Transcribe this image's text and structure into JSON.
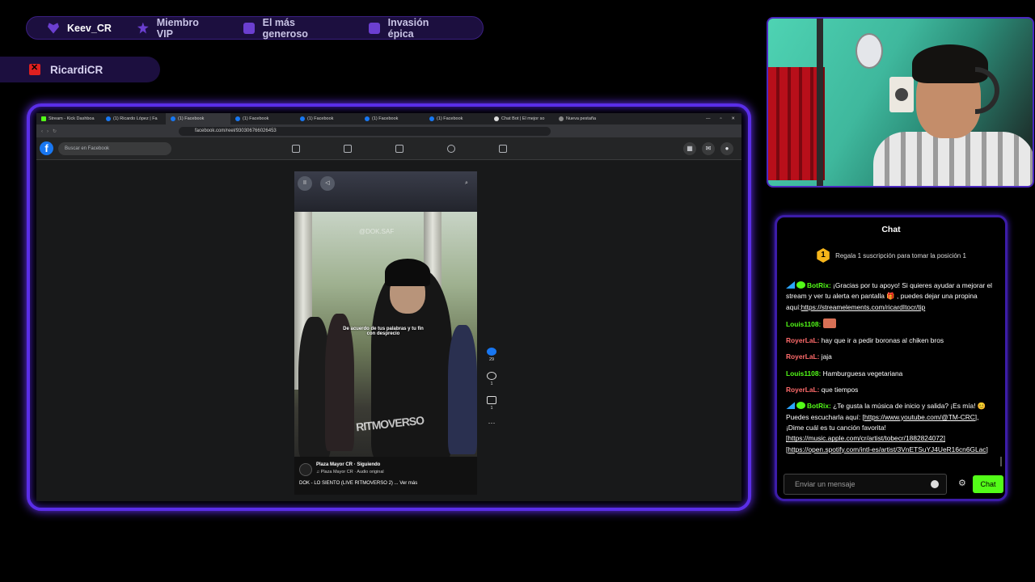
{
  "alerts": {
    "items": [
      {
        "icon": "heart-icon",
        "label": "Keev_CR"
      },
      {
        "icon": "star-icon",
        "label": "Miembro VIP"
      },
      {
        "icon": "gift-icon",
        "label": "El más generoso"
      },
      {
        "icon": "paw-icon",
        "label": "Invasión épica"
      }
    ],
    "streamer": "RicardiCR"
  },
  "browser": {
    "tabs": [
      "Stream - Kick Dashboa",
      "(1) Ricardo López | Fa",
      "(1) Facebook",
      "(1) Facebook",
      "(1) Facebook",
      "(1) Facebook",
      "(1) Facebook",
      "Chat Bot | El mejor so",
      "Nueva pestaña"
    ],
    "url": "facebook.com/reel/930306766026453",
    "search_placeholder": "Buscar en Facebook",
    "fb_logo": "f"
  },
  "reel": {
    "watermark_top": "@DOK.SAF",
    "caption": "De acuerdo de tus palabras y tu fin con desprecio",
    "watermark": "RITMOVERSO",
    "author": "Plaza Mayor CR · Siguiendo",
    "audio": "♫ Plaza Mayor CR · Audio original",
    "description": "DOK - LO SIENTO (LIVE RITMOVERSO 2) ... Ver más",
    "likes": "29",
    "comments": "1",
    "shares": "1"
  },
  "chat": {
    "title": "Chat",
    "pin_rank": "1",
    "pin_text": "Regala 1 suscripción para tomar la posición 1",
    "messages": [
      {
        "user": "BotRix:",
        "type": "bot",
        "text": "¡Gracias por tu apoyo! Si quieres ayudar a mejorar el stream y ver tu alerta en pantalla 🎁 , puedes dejar una propina aquí:",
        "link": "https://streamelements.com/ricardItocr/tip"
      },
      {
        "user": "Louis1108:",
        "type": "l",
        "text": ""
      },
      {
        "user": "RoyerLaL:",
        "type": "r",
        "text": "hay que ir a pedir boronas al chiken bros"
      },
      {
        "user": "RoyerLaL:",
        "type": "r",
        "text": "jaja"
      },
      {
        "user": "Louis1108:",
        "type": "l",
        "text": "Hamburguesa vegetariana"
      },
      {
        "user": "RoyerLaL:",
        "type": "r",
        "text": "que tiempos"
      },
      {
        "user": "BotRix:",
        "type": "bot",
        "text": "¿Te gusta la música de inicio y salida? ¡Es mía! 😊 Puedes escucharla aquí:",
        "link": "[https://www.youtube.com/@TM-CRC]",
        "text2": ", ¡Dime cuál es tu canción favorita!",
        "link2": "[https://music.apple.com/cr/artist/tobecr/1882824072]",
        "link3": "[https://open.spotify.com/intl-es/artist/3VnETSuYJ4UeR16cn6GLac]"
      }
    ],
    "input_placeholder": "Enviar un mensaje",
    "send_label": "Chat"
  }
}
